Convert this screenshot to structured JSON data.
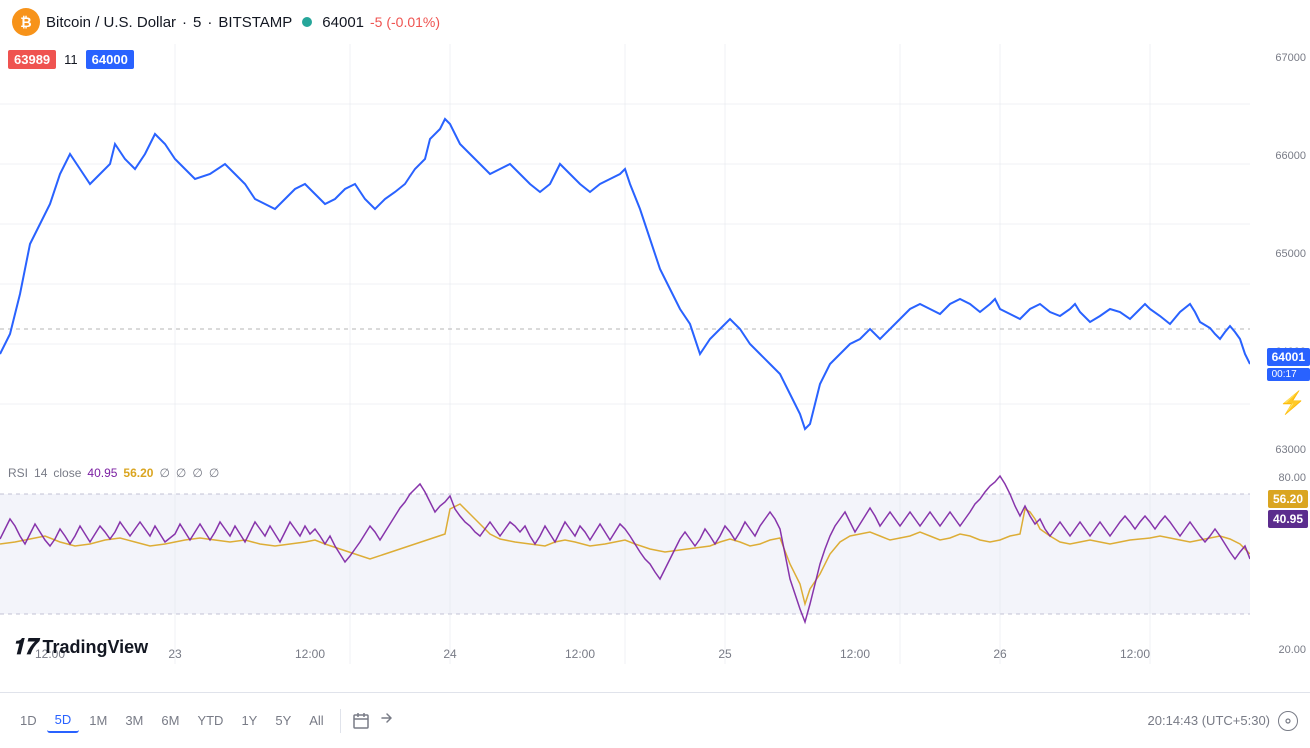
{
  "header": {
    "symbol": "Bitcoin",
    "pair": "Bitcoin / U.S. Dollar",
    "interval": "5",
    "exchange": "BITSTAMP",
    "price": "64001",
    "change": "-5",
    "change_pct": "(-0.01%)",
    "status_dot_color": "#26a69a"
  },
  "price_boxes": {
    "left_price": "63989",
    "middle_num": "11",
    "right_price": "64000"
  },
  "current_price": {
    "value": "64001",
    "time": "00:17"
  },
  "right_axis": {
    "labels": [
      "67000",
      "66000",
      "65000",
      "64000",
      "63000"
    ]
  },
  "rsi": {
    "label": "RSI",
    "period": "14",
    "source": "close",
    "val1": "40.95",
    "val2": "56.20",
    "placeholders": [
      "∅",
      "∅",
      "∅",
      "∅"
    ],
    "badge_yellow": "56.20",
    "badge_purple": "40.95",
    "axis_labels": [
      "80.00",
      "56.20",
      "40.95",
      "20.00"
    ]
  },
  "time_axis": {
    "labels": [
      {
        "text": "12:00",
        "position": "4%"
      },
      {
        "text": "23",
        "position": "14%"
      },
      {
        "text": "12:00",
        "position": "25%"
      },
      {
        "text": "24",
        "position": "36%"
      },
      {
        "text": "12:00",
        "position": "47%"
      },
      {
        "text": "25",
        "position": "58%"
      },
      {
        "text": "12:00",
        "position": "69%"
      },
      {
        "text": "26",
        "position": "80%"
      },
      {
        "text": "12:00",
        "position": "91%"
      }
    ]
  },
  "tv_logo": {
    "icon": "17",
    "text": "TradingView"
  },
  "toolbar": {
    "periods": [
      "1D",
      "5D",
      "1M",
      "3M",
      "6M",
      "YTD",
      "1Y",
      "5Y",
      "All"
    ],
    "active": "5D"
  },
  "bottom_time": "20:14:43 (UTC+5:30)"
}
